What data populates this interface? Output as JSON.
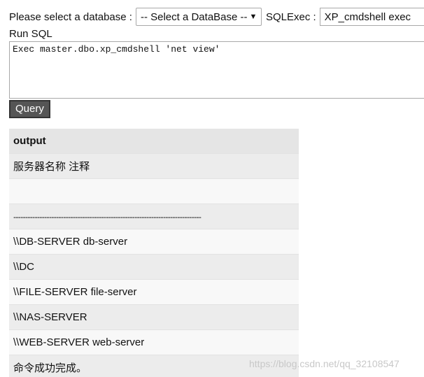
{
  "toolbar": {
    "db_label": "Please select a database :",
    "db_select_value": "-- Select a DataBase --",
    "sqlexec_label": "SQLExec :",
    "sqlexec_value": "XP_cmdshell exec"
  },
  "editor": {
    "run_sql_label": "Run SQL",
    "sql_text": "Exec master.dbo.xp_cmdshell 'net view'"
  },
  "query_button_label": "Query",
  "output": {
    "header": "output",
    "rows": [
      "服务器名称 注释",
      "",
      "-------------------------------------------------------------------------------",
      "\\\\DB-SERVER db-server",
      "\\\\DC",
      "\\\\FILE-SERVER file-server",
      "\\\\NAS-SERVER",
      "\\\\WEB-SERVER web-server",
      "命令成功完成。"
    ]
  },
  "watermark": "https://blog.csdn.net/qq_32108547"
}
